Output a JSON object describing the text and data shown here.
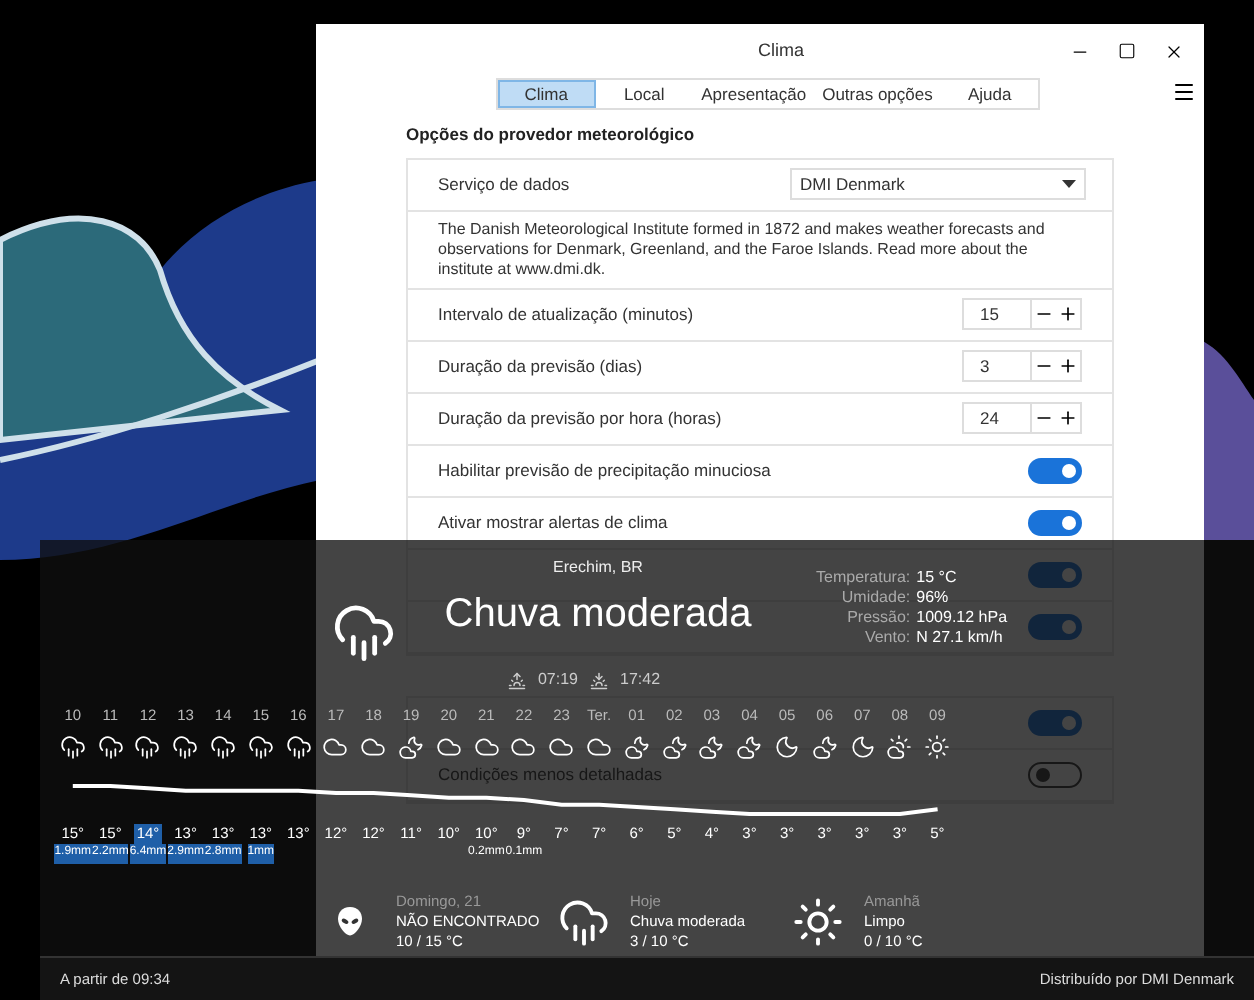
{
  "window": {
    "title": "Clima",
    "tabs": [
      {
        "label": "Clima",
        "selected": true
      },
      {
        "label": "Local",
        "selected": false
      },
      {
        "label": "Apresentação",
        "selected": false
      },
      {
        "label": "Outras opções",
        "selected": false
      },
      {
        "label": "Ajuda",
        "selected": false
      }
    ]
  },
  "provider_section": {
    "title": "Opções do provedor meteorológico",
    "rows": [
      {
        "kind": "dropdown",
        "label": "Serviço de dados",
        "value": "DMI Denmark"
      },
      {
        "kind": "text",
        "text": "The Danish Meteorological Institute formed in 1872 and makes weather forecasts and observations for Denmark, Greenland, and the Faroe Islands. Read more about the institute at www.dmi.dk."
      },
      {
        "kind": "spin",
        "label": "Intervalo de atualização (minutos)",
        "value": "15"
      },
      {
        "kind": "spin",
        "label": "Duração da previsão (dias)",
        "value": "3"
      },
      {
        "kind": "spin",
        "label": "Duração da previsão por hora (horas)",
        "value": "24"
      },
      {
        "kind": "toggle",
        "label": "Habilitar previsão de precipitação minuciosa",
        "on": true
      },
      {
        "kind": "toggle",
        "label": "Ativar mostrar alertas de clima",
        "on": true
      },
      {
        "kind": "toggle",
        "on": true
      },
      {
        "kind": "toggle",
        "on": true
      }
    ]
  },
  "conditions_section": {
    "rows": [
      {
        "kind": "toggle",
        "on": true
      },
      {
        "kind": "toggle",
        "label": "Condições menos detalhadas",
        "on": false
      }
    ]
  },
  "popup": {
    "location": "Erechim, BR",
    "kind": "rain",
    "condition": "Chuva moderada",
    "details": [
      {
        "label": "Temperatura:",
        "value": "15 °C"
      },
      {
        "label": "Umidade:",
        "value": "96%"
      },
      {
        "label": "Pressão:",
        "value": "1009.12 hPa"
      },
      {
        "label": "Vento:",
        "value": "N 27.1 km/h"
      }
    ],
    "sunrise": "07:19",
    "sunset": "17:42",
    "hours": [
      {
        "hour": "10",
        "kind": "rain",
        "temp": "15°",
        "precip": "1.9mm",
        "precip_bar": true,
        "current": false
      },
      {
        "hour": "11",
        "kind": "rain",
        "temp": "15°",
        "precip": "2.2mm",
        "precip_bar": true,
        "current": false
      },
      {
        "hour": "12",
        "kind": "rain",
        "temp": "14°",
        "precip": "6.4mm",
        "precip_bar": true,
        "current": true
      },
      {
        "hour": "13",
        "kind": "rain",
        "temp": "13°",
        "precip": "2.9mm",
        "precip_bar": true,
        "current": false
      },
      {
        "hour": "14",
        "kind": "rain",
        "temp": "13°",
        "precip": "2.8mm",
        "precip_bar": true,
        "current": false
      },
      {
        "hour": "15",
        "kind": "rain",
        "temp": "13°",
        "precip": "1mm",
        "precip_bar": true,
        "current": false
      },
      {
        "hour": "16",
        "kind": "rain",
        "temp": "13°",
        "current": false
      },
      {
        "hour": "17",
        "kind": "cloudy",
        "temp": "12°",
        "current": false
      },
      {
        "hour": "18",
        "kind": "cloudy",
        "temp": "12°",
        "current": false
      },
      {
        "hour": "19",
        "kind": "cloud-moon",
        "temp": "11°",
        "current": false
      },
      {
        "hour": "20",
        "kind": "cloudy",
        "temp": "10°",
        "current": false
      },
      {
        "hour": "21",
        "kind": "cloudy",
        "temp": "10°",
        "precip": "0.2mm",
        "precip_bar": false,
        "current": false
      },
      {
        "hour": "22",
        "kind": "cloudy",
        "temp": "9°",
        "precip": "0.1mm",
        "precip_bar": false,
        "current": false
      },
      {
        "hour": "23",
        "kind": "cloudy",
        "temp": "7°",
        "current": false
      },
      {
        "hour": "Ter.",
        "kind": "cloudy",
        "temp": "7°",
        "current": false
      },
      {
        "hour": "01",
        "kind": "cloud-moon",
        "temp": "6°",
        "current": false
      },
      {
        "hour": "02",
        "kind": "cloud-moon",
        "temp": "5°",
        "current": false
      },
      {
        "hour": "03",
        "kind": "cloud-moon",
        "temp": "4°",
        "current": false
      },
      {
        "hour": "04",
        "kind": "cloud-moon",
        "temp": "3°",
        "current": false
      },
      {
        "hour": "05",
        "kind": "moon",
        "temp": "3°",
        "current": false
      },
      {
        "hour": "06",
        "kind": "cloud-moon",
        "temp": "3°",
        "current": false
      },
      {
        "hour": "07",
        "kind": "moon",
        "temp": "3°",
        "current": false
      },
      {
        "hour": "08",
        "kind": "cloud-sun",
        "temp": "3°",
        "current": false
      },
      {
        "hour": "09",
        "kind": "sun",
        "temp": "5°",
        "current": false
      }
    ],
    "days": [
      {
        "day": "Domingo, 21",
        "kind": "alien",
        "condition": "NÃO ENCONTRADO",
        "temps": "10 / 15 °C"
      },
      {
        "day": "Hoje",
        "kind": "rain",
        "condition": "Chuva moderada",
        "temps": "3 / 10 °C"
      },
      {
        "day": "Amanhã",
        "kind": "sun",
        "condition": "Limpo",
        "temps": "0 / 10 °C"
      }
    ]
  },
  "status_bar": {
    "updated": "A partir de 09:34",
    "provider": "Distribuído por DMI Denmark"
  }
}
